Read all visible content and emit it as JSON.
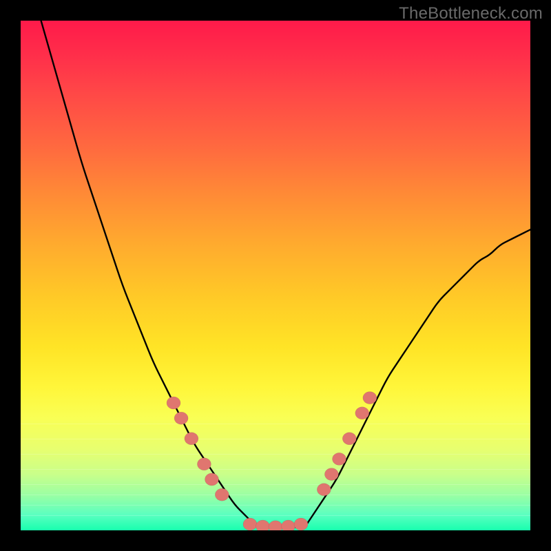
{
  "watermark": "TheBottleneck.com",
  "colors": {
    "background": "#000000",
    "curve": "#000000",
    "dot": "#e0766f",
    "gradient_top": "#ff1a4a",
    "gradient_bottom": "#18ffae"
  },
  "chart_data": {
    "type": "line",
    "title": "",
    "xlabel": "",
    "ylabel": "",
    "xlim": [
      0,
      100
    ],
    "ylim": [
      0,
      100
    ],
    "grid": false,
    "legend": false,
    "series": [
      {
        "name": "bottleneck-curve-left",
        "x": [
          4,
          6,
          8,
          10,
          12,
          14,
          16,
          18,
          20,
          22,
          24,
          26,
          28,
          30,
          32,
          34,
          36,
          38,
          40,
          42,
          44,
          46
        ],
        "y": [
          100,
          93,
          86,
          79,
          72,
          66,
          60,
          54,
          48,
          43,
          38,
          33,
          29,
          25,
          21,
          17,
          14,
          11,
          8,
          5,
          3,
          1
        ]
      },
      {
        "name": "bottleneck-curve-floor",
        "x": [
          46,
          48,
          50,
          52,
          54,
          56
        ],
        "y": [
          1,
          0.5,
          0.5,
          0.5,
          0.6,
          1
        ]
      },
      {
        "name": "bottleneck-curve-right",
        "x": [
          56,
          58,
          60,
          62,
          64,
          66,
          68,
          70,
          72,
          74,
          76,
          78,
          80,
          82,
          84,
          86,
          88,
          90,
          92,
          94,
          96,
          98,
          100
        ],
        "y": [
          1,
          4,
          7,
          10,
          14,
          18,
          22,
          26,
          30,
          33,
          36,
          39,
          42,
          45,
          47,
          49,
          51,
          53,
          54,
          56,
          57,
          58,
          59
        ]
      }
    ],
    "markers": [
      {
        "series": "dots-left",
        "x": 30.0,
        "y": 25
      },
      {
        "series": "dots-left",
        "x": 31.5,
        "y": 22
      },
      {
        "series": "dots-left",
        "x": 33.5,
        "y": 18
      },
      {
        "series": "dots-left",
        "x": 36.0,
        "y": 13
      },
      {
        "series": "dots-left",
        "x": 37.5,
        "y": 10
      },
      {
        "series": "dots-left",
        "x": 39.5,
        "y": 7
      },
      {
        "series": "dots-floor",
        "x": 45.0,
        "y": 1.2
      },
      {
        "series": "dots-floor",
        "x": 47.5,
        "y": 0.8
      },
      {
        "series": "dots-floor",
        "x": 50.0,
        "y": 0.7
      },
      {
        "series": "dots-floor",
        "x": 52.5,
        "y": 0.8
      },
      {
        "series": "dots-floor",
        "x": 55.0,
        "y": 1.2
      },
      {
        "series": "dots-right",
        "x": 59.5,
        "y": 8
      },
      {
        "series": "dots-right",
        "x": 61.0,
        "y": 11
      },
      {
        "series": "dots-right",
        "x": 62.5,
        "y": 14
      },
      {
        "series": "dots-right",
        "x": 64.5,
        "y": 18
      },
      {
        "series": "dots-right",
        "x": 67.0,
        "y": 23
      },
      {
        "series": "dots-right",
        "x": 68.5,
        "y": 26
      }
    ],
    "annotations": [
      {
        "text": "TheBottleneck.com",
        "position": "top-right"
      }
    ]
  }
}
